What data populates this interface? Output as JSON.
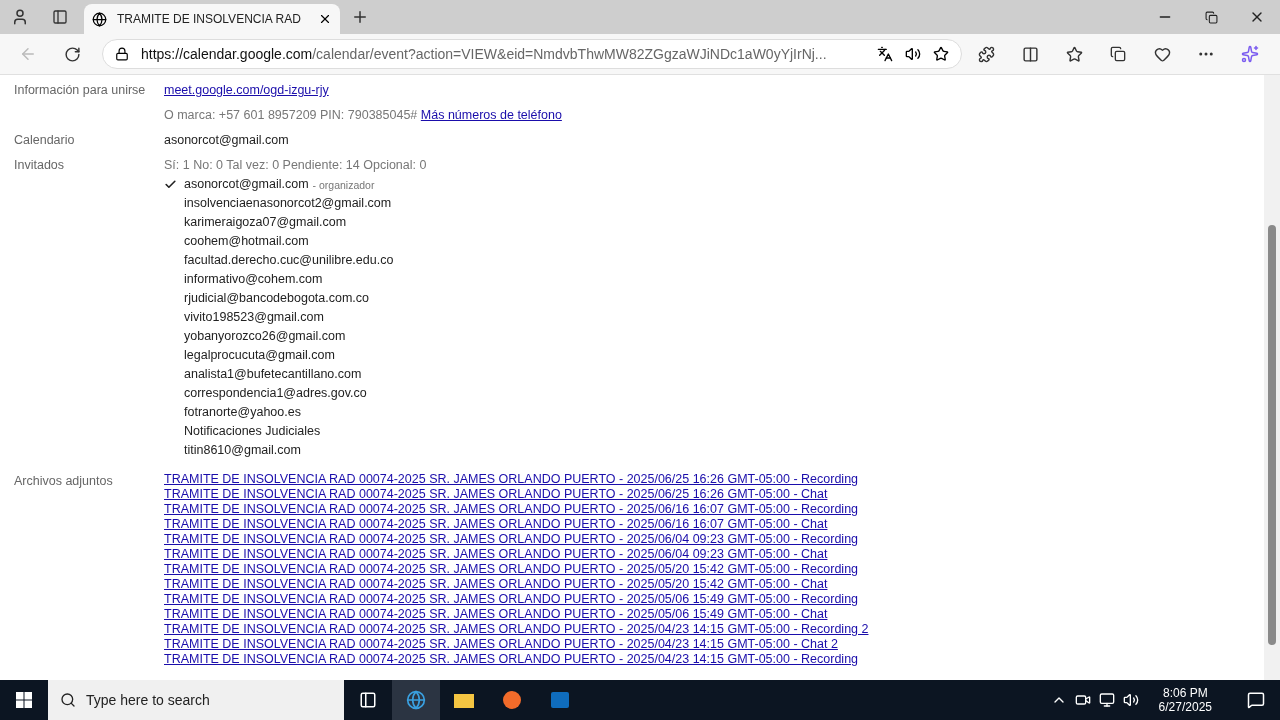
{
  "browser": {
    "tab_title": "TRAMITE DE INSOLVENCIA RAD",
    "url_host": "https://calendar.google.com",
    "url_path": "/calendar/event?action=VIEW&eid=NmdvbThwMW82ZGgzaWJiNDc1aW0yYjIrNj..."
  },
  "join": {
    "label": "Información para unirse",
    "link": "meet.google.com/ogd-izgu-rjy",
    "phone": "O marca: +57 601 8957209  PIN: 790385045#",
    "phone_link": "Más números de teléfono"
  },
  "calendar": {
    "label": "Calendario",
    "value": "asonorcot@gmail.com"
  },
  "guests": {
    "label": "Invitados",
    "summary": "Sí: 1  No: 0  Tal vez: 0  Pendiente: 14  Opcional: 0",
    "items": [
      {
        "email": "asonorcot@gmail.com",
        "role": "- organizador",
        "checked": true
      },
      {
        "email": "insolvenciaenasonorcot2@gmail.com",
        "checked": false
      },
      {
        "email": "karimeraigoza07@gmail.com",
        "checked": false
      },
      {
        "email": "coohem@hotmail.com",
        "checked": false
      },
      {
        "email": "facultad.derecho.cuc@unilibre.edu.co",
        "checked": false
      },
      {
        "email": "informativo@cohem.com",
        "checked": false
      },
      {
        "email": "rjudicial@bancodebogota.com.co",
        "checked": false
      },
      {
        "email": "vivito198523@gmail.com",
        "checked": false
      },
      {
        "email": "yobanyorozco26@gmail.com",
        "checked": false
      },
      {
        "email": "legalprocucuta@gmail.com",
        "checked": false
      },
      {
        "email": "analista1@bufetecantillano.com",
        "checked": false
      },
      {
        "email": "correspondencia1@adres.gov.co",
        "checked": false
      },
      {
        "email": "fotranorte@yahoo.es",
        "checked": false
      },
      {
        "email": "Notificaciones Judiciales",
        "checked": false
      },
      {
        "email": "titin8610@gmail.com",
        "checked": false
      }
    ]
  },
  "attachments": {
    "label": "Archivos adjuntos",
    "items": [
      "TRAMITE DE INSOLVENCIA RAD 00074-2025 SR. JAMES ORLANDO PUERTO - 2025/06/25 16:26 GMT-05:00 - Recording",
      "TRAMITE DE INSOLVENCIA RAD 00074-2025 SR. JAMES ORLANDO PUERTO - 2025/06/25 16:26 GMT-05:00 - Chat",
      "TRAMITE DE INSOLVENCIA RAD 00074-2025 SR. JAMES ORLANDO PUERTO - 2025/06/16 16:07 GMT-05:00 - Recording",
      "TRAMITE DE INSOLVENCIA RAD 00074-2025 SR. JAMES ORLANDO PUERTO - 2025/06/16 16:07 GMT-05:00 - Chat",
      "TRAMITE DE INSOLVENCIA RAD 00074-2025 SR. JAMES ORLANDO PUERTO - 2025/06/04 09:23 GMT-05:00 - Recording",
      "TRAMITE DE INSOLVENCIA RAD 00074-2025 SR. JAMES ORLANDO PUERTO - 2025/06/04 09:23 GMT-05:00 - Chat",
      "TRAMITE DE INSOLVENCIA RAD 00074-2025 SR. JAMES ORLANDO PUERTO - 2025/05/20 15:42 GMT-05:00 - Recording",
      "TRAMITE DE INSOLVENCIA RAD 00074-2025 SR. JAMES ORLANDO PUERTO - 2025/05/20 15:42 GMT-05:00 - Chat",
      "TRAMITE DE INSOLVENCIA RAD 00074-2025 SR. JAMES ORLANDO PUERTO - 2025/05/06 15:49 GMT-05:00 - Recording",
      "TRAMITE DE INSOLVENCIA RAD 00074-2025 SR. JAMES ORLANDO PUERTO - 2025/05/06 15:49 GMT-05:00 - Chat",
      "TRAMITE DE INSOLVENCIA RAD 00074-2025 SR. JAMES ORLANDO PUERTO - 2025/04/23 14:15 GMT-05:00 - Recording 2",
      "TRAMITE DE INSOLVENCIA RAD 00074-2025 SR. JAMES ORLANDO PUERTO - 2025/04/23 14:15 GMT-05:00 - Chat 2",
      "TRAMITE DE INSOLVENCIA RAD 00074-2025 SR. JAMES ORLANDO PUERTO - 2025/04/23 14:15 GMT-05:00 - Recording"
    ]
  },
  "taskbar": {
    "search_placeholder": "Type here to search",
    "time": "8:06 PM",
    "date": "6/27/2025"
  }
}
